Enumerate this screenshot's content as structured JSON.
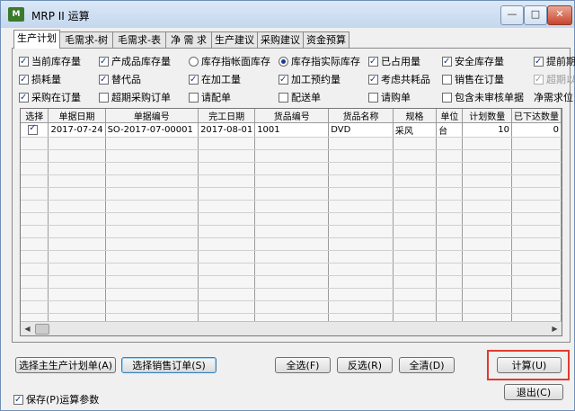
{
  "window": {
    "title": "MRP II 运算",
    "icon": "app-icon",
    "min_symbol": "—",
    "max_symbol": "□",
    "close_symbol": "✕"
  },
  "tabs": [
    {
      "label": "生产计划",
      "active": true
    },
    {
      "label": "毛需求-树",
      "active": false
    },
    {
      "label": "毛需求-表",
      "active": false
    },
    {
      "label": "净 需 求",
      "active": false
    },
    {
      "label": "生产建议",
      "active": false
    },
    {
      "label": "采购建议",
      "active": false
    },
    {
      "label": "资金预算",
      "active": false
    }
  ],
  "options": {
    "current_stock": {
      "label": "当前库存量",
      "checked": true
    },
    "product_stock": {
      "label": "产成品库存量",
      "checked": true
    },
    "stock_book": {
      "label": "库存指帐面库存",
      "checked": false
    },
    "stock_actual": {
      "label": "库存指实际库存",
      "checked": true
    },
    "occupied": {
      "label": "已占用量",
      "checked": true
    },
    "safety_stock": {
      "label": "安全库存量",
      "checked": true
    },
    "lead_time": {
      "label": "提前期",
      "checked": true
    },
    "loss": {
      "label": "损耗量",
      "checked": true
    },
    "substitute": {
      "label": "替代品",
      "checked": true
    },
    "wip": {
      "label": "在加工量",
      "checked": true
    },
    "processing_reserve": {
      "label": "加工预约量",
      "checked": true
    },
    "common_consumable": {
      "label": "考虑共耗品",
      "checked": true
    },
    "sales_on_order": {
      "label": "销售在订量",
      "checked": false
    },
    "overdue_label": {
      "label": "超期以",
      "checked": true
    },
    "purchase_on_order": {
      "label": "采购在订量",
      "checked": true
    },
    "overdue_purchase": {
      "label": "超期采购订单",
      "checked": false
    },
    "requisition": {
      "label": "请配单",
      "checked": false
    },
    "delivery": {
      "label": "配送单",
      "checked": false
    },
    "purchase_request": {
      "label": "请购单",
      "checked": false
    },
    "include_unapproved": {
      "label": "包含未审核单据",
      "checked": false
    },
    "net_demand_label": "净需求位"
  },
  "table": {
    "headers": [
      "选择",
      "单据日期",
      "单据编号",
      "完工日期",
      "货品编号",
      "货品名称",
      "规格",
      "单位",
      "计划数量",
      "已下达数量"
    ],
    "rows": [
      {
        "checked": true,
        "date": "2017-07-24",
        "doc_no": "SO-2017-07-00001",
        "finish": "2017-08-01",
        "item_no": "1001",
        "item_name": "DVD",
        "spec": "采风",
        "unit": "台",
        "plan_qty": "10",
        "issued_qty": "0"
      }
    ]
  },
  "buttons": {
    "select_master_plan": "选择主生产计划单(A)",
    "select_sales_order": "选择销售订单(S)",
    "select_all": "全选(F)",
    "invert": "反选(R)",
    "clear_all": "全清(D)",
    "calculate": "计算(U)",
    "exit": "退出(C)"
  },
  "save_params": {
    "label": "保存(P)运算参数",
    "checked": true
  }
}
